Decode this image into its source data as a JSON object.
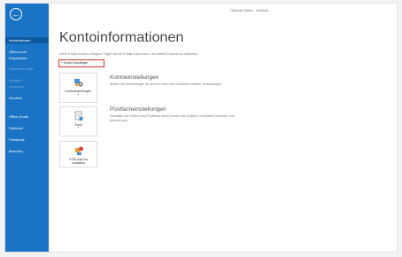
{
  "window": {
    "title": "Outlook Heute - Outlook"
  },
  "sidebar": {
    "items": [
      {
        "label": "Informationen",
        "active": true,
        "dim": false
      },
      {
        "label": "Öffnen und",
        "active": false,
        "dim": false
      },
      {
        "label": "Exportieren",
        "active": false,
        "dim": false
      },
      {
        "label": "Speichern unter",
        "active": false,
        "dim": true
      },
      {
        "label": "Anlagen",
        "active": false,
        "dim": true
      },
      {
        "label": "speichern",
        "active": false,
        "dim": true
      },
      {
        "label": "Drucken",
        "active": false,
        "dim": false
      },
      {
        "label": "Office-Konto",
        "active": false,
        "dim": false
      },
      {
        "label": "Optionen",
        "active": false,
        "dim": false
      },
      {
        "label": "Feedback",
        "active": false,
        "dim": false
      },
      {
        "label": "Beenden",
        "active": false,
        "dim": false
      }
    ]
  },
  "page": {
    "title": "Kontoinformationen",
    "subtitle": "Keine E-Mail-Konten verfügbar. Fügen Sie ein E-Mail-Konto hinzu, um weitere Features zu aktivieren.",
    "add_account_label": "Konto hinzufügen"
  },
  "sections": {
    "account_settings": {
      "tile_label": "Kontoeinstellungen",
      "title": "Kontoeinstellungen",
      "description": "Ändern der Einstellungen für dieses Konto oder Einrichten weiterer Verbindungen."
    },
    "mailbox_settings": {
      "tile_label": "Tools",
      "title": "Postfacheinstellungen",
      "description": "Verwalten der Größe Ihres Postfachs durch Leeren des Ordners \"Gelöschte Elemente\" und Archivierung."
    },
    "com_addins": {
      "tile_label": "COM-Add-Ins verwalten"
    }
  },
  "colors": {
    "sidebar": "#1a73c4",
    "sidebar_active": "#0d5aa3",
    "highlight_box": "#d23a2f"
  }
}
